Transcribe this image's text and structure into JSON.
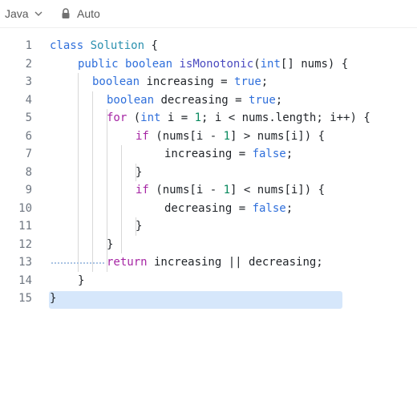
{
  "toolbar": {
    "language_label": "Java",
    "auto_label": "Auto"
  },
  "icons": {
    "chevron": "chevron-down-icon",
    "lock": "lock-icon"
  },
  "colors": {
    "keyword": "#a626a4",
    "type": "#2f6fdb",
    "class_name": "#2b91af",
    "number": "#0a8a5f",
    "line_number": "#6e7681",
    "highlight": "#d6e7fb"
  },
  "editor": {
    "highlighted_line": 13,
    "lines": [
      {
        "n": "1",
        "tokens": [
          {
            "t": "class",
            "c": "kw2"
          },
          {
            "t": " ",
            "c": "pl"
          },
          {
            "t": "Solution",
            "c": "cls"
          },
          {
            "t": " {",
            "c": "pl"
          }
        ]
      },
      {
        "n": "2",
        "tokens": [
          {
            "t": "public",
            "c": "kw2"
          },
          {
            "t": " ",
            "c": "pl"
          },
          {
            "t": "boolean",
            "c": "ty"
          },
          {
            "t": " ",
            "c": "pl"
          },
          {
            "t": "isMonotonic",
            "c": "fn"
          },
          {
            "t": "(",
            "c": "pl"
          },
          {
            "t": "int",
            "c": "ty"
          },
          {
            "t": "[] nums) {",
            "c": "pl"
          }
        ]
      },
      {
        "n": "3",
        "tokens": [
          {
            "t": "boolean",
            "c": "ty"
          },
          {
            "t": " increasing = ",
            "c": "pl"
          },
          {
            "t": "true",
            "c": "kw2"
          },
          {
            "t": ";",
            "c": "pl"
          }
        ]
      },
      {
        "n": "4",
        "tokens": [
          {
            "t": "boolean",
            "c": "ty"
          },
          {
            "t": " decreasing = ",
            "c": "pl"
          },
          {
            "t": "true",
            "c": "kw2"
          },
          {
            "t": ";",
            "c": "pl"
          }
        ]
      },
      {
        "n": "5",
        "tokens": [
          {
            "t": "for",
            "c": "kw"
          },
          {
            "t": " (",
            "c": "pl"
          },
          {
            "t": "int",
            "c": "ty"
          },
          {
            "t": " i = ",
            "c": "pl"
          },
          {
            "t": "1",
            "c": "num"
          },
          {
            "t": "; i < nums.length; i++) {",
            "c": "pl"
          }
        ]
      },
      {
        "n": "6",
        "tokens": [
          {
            "t": "if",
            "c": "kw"
          },
          {
            "t": " (nums[i - ",
            "c": "pl"
          },
          {
            "t": "1",
            "c": "num"
          },
          {
            "t": "] > nums[i]) {",
            "c": "pl"
          }
        ]
      },
      {
        "n": "7",
        "tokens": [
          {
            "t": "increasing = ",
            "c": "pl"
          },
          {
            "t": "false",
            "c": "kw2"
          },
          {
            "t": ";",
            "c": "pl"
          }
        ]
      },
      {
        "n": "8",
        "tokens": [
          {
            "t": "}",
            "c": "pl"
          }
        ]
      },
      {
        "n": "9",
        "tokens": [
          {
            "t": "if",
            "c": "kw"
          },
          {
            "t": " (nums[i - ",
            "c": "pl"
          },
          {
            "t": "1",
            "c": "num"
          },
          {
            "t": "] < nums[i]) {",
            "c": "pl"
          }
        ]
      },
      {
        "n": "10",
        "tokens": [
          {
            "t": "decreasing = ",
            "c": "pl"
          },
          {
            "t": "false",
            "c": "kw2"
          },
          {
            "t": ";",
            "c": "pl"
          }
        ]
      },
      {
        "n": "11",
        "tokens": [
          {
            "t": "}",
            "c": "pl"
          }
        ]
      },
      {
        "n": "12",
        "tokens": [
          {
            "t": "}",
            "c": "pl"
          }
        ]
      },
      {
        "n": "13",
        "tokens": [
          {
            "t": "return",
            "c": "kw"
          },
          {
            "t": " increasing || decreasing;",
            "c": "pl"
          }
        ]
      },
      {
        "n": "14",
        "tokens": [
          {
            "t": "}",
            "c": "pl"
          }
        ]
      },
      {
        "n": "15",
        "tokens": [
          {
            "t": "}",
            "c": "pl"
          }
        ]
      }
    ]
  }
}
